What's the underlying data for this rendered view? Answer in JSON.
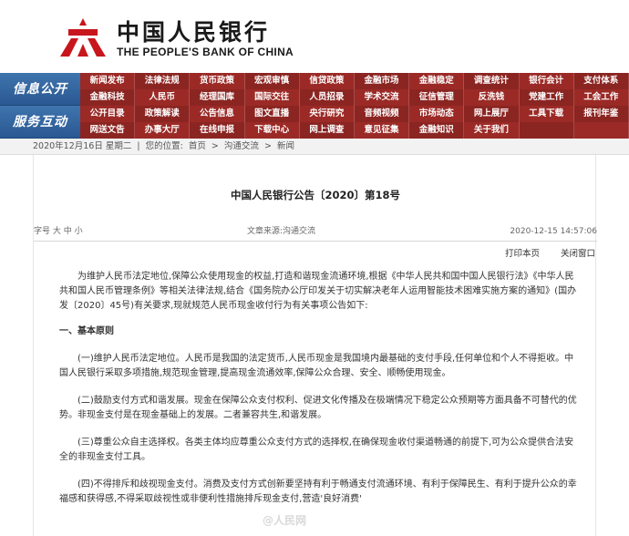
{
  "header": {
    "brand_cn": "中国人民银行",
    "brand_en": "THE PEOPLE'S BANK OF CHINA",
    "logo_color": "#c8161d"
  },
  "nav": {
    "groups": [
      {
        "label": "信息公开",
        "items": [
          "新闻发布",
          "法律法规",
          "货币政策",
          "宏观审慎",
          "信贷政策",
          "金融市场",
          "金融稳定",
          "调查统计",
          "银行会计",
          "支付体系",
          "金融科技",
          "人民币",
          "经理国库",
          "国际交往",
          "人员招录",
          "学术交流",
          "征信管理",
          "反洗钱",
          "党建工作",
          "工会工作"
        ]
      },
      {
        "label": "服务互动",
        "items": [
          "公开目录",
          "政策解读",
          "公告信息",
          "图文直播",
          "央行研究",
          "音频视频",
          "市场动态",
          "网上展厅",
          "工具下载",
          "报刊年鉴",
          "网送文告",
          "办事大厅",
          "在线申报",
          "下载中心",
          "网上调查",
          "意见征集",
          "金融知识",
          "关于我们",
          "",
          ""
        ]
      }
    ],
    "colors": {
      "bar": "#9b2a26",
      "label": "#2a5892"
    }
  },
  "breadcrumb": {
    "date": "2020年12月16日 星期二",
    "location_prefix": "您的位置:",
    "home": "首页",
    "level1": "沟通交流",
    "level2": "新闻",
    "sep": "|",
    "arrow": ">"
  },
  "article": {
    "title": "中国人民银行公告〔2020〕第18号",
    "font_size": "字号 大 中 小",
    "source": "文章来源:沟通交流",
    "timestamp": "2020-12-15 14:57:06",
    "print_label": "打印本页",
    "close_label": "关闭窗口",
    "paragraphs": [
      "为维护人民币法定地位,保障公众使用现金的权益,打造和谐现金流通环境,根据《中华人民共和国中国人民银行法》《中华人民共和国人民币管理条例》等相关法律法规,结合《国务院办公厅印发关于切实解决老年人运用智能技术困难实施方案的通知》(国办发〔2020〕45号)有关要求,现就规范人民币现金收付行为有关事项公告如下:",
      "一、基本原则",
      "(一)维护人民币法定地位。人民币是我国的法定货币,人民币现金是我国境内最基础的支付手段,任何单位和个人不得拒收。中国人民银行采取多项措施,规范现金管理,提高现金流通效率,保障公众合理、安全、顺畅使用现金。",
      "(二)鼓励支付方式和谐发展。现金在保障公众支付权利、促进文化传播及在极端情况下稳定公众预期等方面具备不可替代的优势。非现金支付是在现金基础上的发展。二者兼容共生,和谐发展。",
      "(三)尊重公众自主选择权。各类主体均应尊重公众支付方式的选择权,在确保现金收付渠道畅通的前提下,可为公众提供合法安全的非现金支付工具。",
      "(四)不得排斥和歧视现金支付。消费及支付方式创新要坚持有利于畅通支付流通环境、有利于保障民生、有利于提升公众的幸福感和获得感,不得采取歧视性或非便利性措施排斥现金支付,营造'良好消费'"
    ]
  },
  "watermark": "@人民网"
}
